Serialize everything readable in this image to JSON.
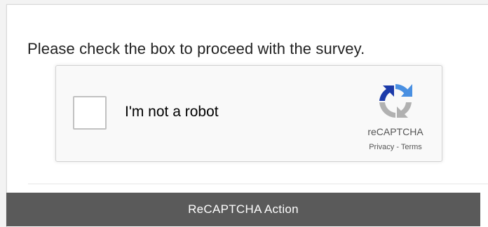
{
  "instruction": "Please check the box to proceed with the survey.",
  "captcha": {
    "label": "I'm not a robot",
    "brand": "reCAPTCHA",
    "privacy": "Privacy",
    "separator": " - ",
    "terms": "Terms",
    "logo_icon": "recaptcha-logo-icon"
  },
  "action": {
    "label": "ReCAPTCHA Action"
  },
  "colors": {
    "action_bar": "#5a5a5a",
    "logo_blue_dark": "#1c3aa9",
    "logo_blue": "#4a90e2",
    "logo_gray": "#b1b1b1"
  }
}
